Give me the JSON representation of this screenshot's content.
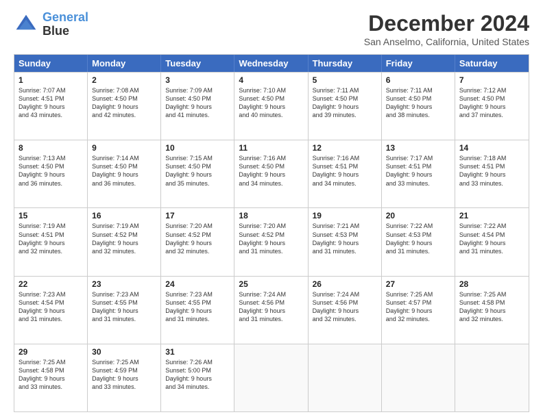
{
  "logo": {
    "line1": "General",
    "line2": "Blue"
  },
  "title": "December 2024",
  "subtitle": "San Anselmo, California, United States",
  "header_days": [
    "Sunday",
    "Monday",
    "Tuesday",
    "Wednesday",
    "Thursday",
    "Friday",
    "Saturday"
  ],
  "weeks": [
    [
      {
        "day": "1",
        "lines": [
          "Sunrise: 7:07 AM",
          "Sunset: 4:51 PM",
          "Daylight: 9 hours",
          "and 43 minutes."
        ]
      },
      {
        "day": "2",
        "lines": [
          "Sunrise: 7:08 AM",
          "Sunset: 4:50 PM",
          "Daylight: 9 hours",
          "and 42 minutes."
        ]
      },
      {
        "day": "3",
        "lines": [
          "Sunrise: 7:09 AM",
          "Sunset: 4:50 PM",
          "Daylight: 9 hours",
          "and 41 minutes."
        ]
      },
      {
        "day": "4",
        "lines": [
          "Sunrise: 7:10 AM",
          "Sunset: 4:50 PM",
          "Daylight: 9 hours",
          "and 40 minutes."
        ]
      },
      {
        "day": "5",
        "lines": [
          "Sunrise: 7:11 AM",
          "Sunset: 4:50 PM",
          "Daylight: 9 hours",
          "and 39 minutes."
        ]
      },
      {
        "day": "6",
        "lines": [
          "Sunrise: 7:11 AM",
          "Sunset: 4:50 PM",
          "Daylight: 9 hours",
          "and 38 minutes."
        ]
      },
      {
        "day": "7",
        "lines": [
          "Sunrise: 7:12 AM",
          "Sunset: 4:50 PM",
          "Daylight: 9 hours",
          "and 37 minutes."
        ]
      }
    ],
    [
      {
        "day": "8",
        "lines": [
          "Sunrise: 7:13 AM",
          "Sunset: 4:50 PM",
          "Daylight: 9 hours",
          "and 36 minutes."
        ]
      },
      {
        "day": "9",
        "lines": [
          "Sunrise: 7:14 AM",
          "Sunset: 4:50 PM",
          "Daylight: 9 hours",
          "and 36 minutes."
        ]
      },
      {
        "day": "10",
        "lines": [
          "Sunrise: 7:15 AM",
          "Sunset: 4:50 PM",
          "Daylight: 9 hours",
          "and 35 minutes."
        ]
      },
      {
        "day": "11",
        "lines": [
          "Sunrise: 7:16 AM",
          "Sunset: 4:50 PM",
          "Daylight: 9 hours",
          "and 34 minutes."
        ]
      },
      {
        "day": "12",
        "lines": [
          "Sunrise: 7:16 AM",
          "Sunset: 4:51 PM",
          "Daylight: 9 hours",
          "and 34 minutes."
        ]
      },
      {
        "day": "13",
        "lines": [
          "Sunrise: 7:17 AM",
          "Sunset: 4:51 PM",
          "Daylight: 9 hours",
          "and 33 minutes."
        ]
      },
      {
        "day": "14",
        "lines": [
          "Sunrise: 7:18 AM",
          "Sunset: 4:51 PM",
          "Daylight: 9 hours",
          "and 33 minutes."
        ]
      }
    ],
    [
      {
        "day": "15",
        "lines": [
          "Sunrise: 7:19 AM",
          "Sunset: 4:51 PM",
          "Daylight: 9 hours",
          "and 32 minutes."
        ]
      },
      {
        "day": "16",
        "lines": [
          "Sunrise: 7:19 AM",
          "Sunset: 4:52 PM",
          "Daylight: 9 hours",
          "and 32 minutes."
        ]
      },
      {
        "day": "17",
        "lines": [
          "Sunrise: 7:20 AM",
          "Sunset: 4:52 PM",
          "Daylight: 9 hours",
          "and 32 minutes."
        ]
      },
      {
        "day": "18",
        "lines": [
          "Sunrise: 7:20 AM",
          "Sunset: 4:52 PM",
          "Daylight: 9 hours",
          "and 31 minutes."
        ]
      },
      {
        "day": "19",
        "lines": [
          "Sunrise: 7:21 AM",
          "Sunset: 4:53 PM",
          "Daylight: 9 hours",
          "and 31 minutes."
        ]
      },
      {
        "day": "20",
        "lines": [
          "Sunrise: 7:22 AM",
          "Sunset: 4:53 PM",
          "Daylight: 9 hours",
          "and 31 minutes."
        ]
      },
      {
        "day": "21",
        "lines": [
          "Sunrise: 7:22 AM",
          "Sunset: 4:54 PM",
          "Daylight: 9 hours",
          "and 31 minutes."
        ]
      }
    ],
    [
      {
        "day": "22",
        "lines": [
          "Sunrise: 7:23 AM",
          "Sunset: 4:54 PM",
          "Daylight: 9 hours",
          "and 31 minutes."
        ]
      },
      {
        "day": "23",
        "lines": [
          "Sunrise: 7:23 AM",
          "Sunset: 4:55 PM",
          "Daylight: 9 hours",
          "and 31 minutes."
        ]
      },
      {
        "day": "24",
        "lines": [
          "Sunrise: 7:23 AM",
          "Sunset: 4:55 PM",
          "Daylight: 9 hours",
          "and 31 minutes."
        ]
      },
      {
        "day": "25",
        "lines": [
          "Sunrise: 7:24 AM",
          "Sunset: 4:56 PM",
          "Daylight: 9 hours",
          "and 31 minutes."
        ]
      },
      {
        "day": "26",
        "lines": [
          "Sunrise: 7:24 AM",
          "Sunset: 4:56 PM",
          "Daylight: 9 hours",
          "and 32 minutes."
        ]
      },
      {
        "day": "27",
        "lines": [
          "Sunrise: 7:25 AM",
          "Sunset: 4:57 PM",
          "Daylight: 9 hours",
          "and 32 minutes."
        ]
      },
      {
        "day": "28",
        "lines": [
          "Sunrise: 7:25 AM",
          "Sunset: 4:58 PM",
          "Daylight: 9 hours",
          "and 32 minutes."
        ]
      }
    ],
    [
      {
        "day": "29",
        "lines": [
          "Sunrise: 7:25 AM",
          "Sunset: 4:58 PM",
          "Daylight: 9 hours",
          "and 33 minutes."
        ]
      },
      {
        "day": "30",
        "lines": [
          "Sunrise: 7:25 AM",
          "Sunset: 4:59 PM",
          "Daylight: 9 hours",
          "and 33 minutes."
        ]
      },
      {
        "day": "31",
        "lines": [
          "Sunrise: 7:26 AM",
          "Sunset: 5:00 PM",
          "Daylight: 9 hours",
          "and 34 minutes."
        ]
      },
      null,
      null,
      null,
      null
    ]
  ]
}
